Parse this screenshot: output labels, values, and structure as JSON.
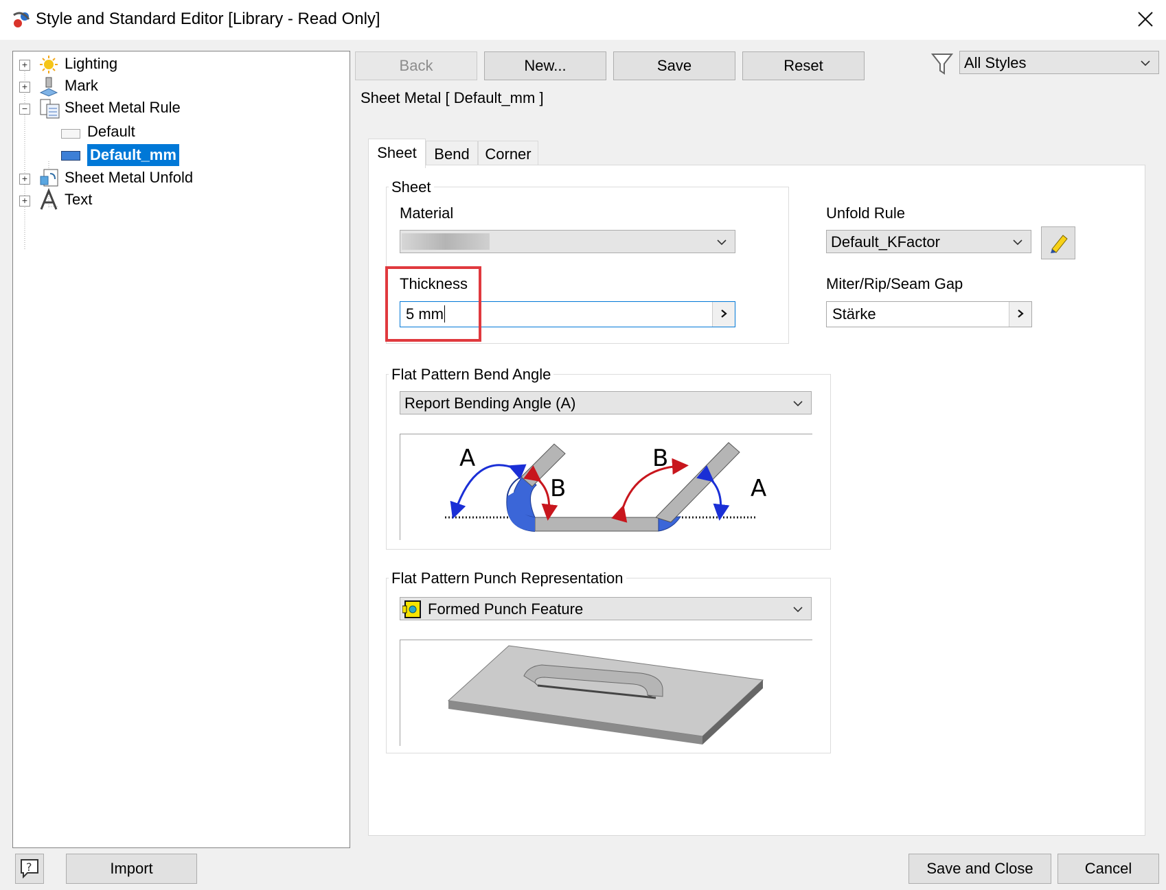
{
  "window": {
    "title": "Style and Standard Editor [Library - Read Only]"
  },
  "tree": {
    "items": [
      {
        "label": "Lighting",
        "icon": "lighting-icon",
        "expander": "+"
      },
      {
        "label": "Mark",
        "icon": "mark-icon",
        "expander": "+"
      },
      {
        "label": "Sheet Metal Rule",
        "icon": "sheet-metal-rule-icon",
        "expander": "−"
      },
      {
        "label": "Default",
        "icon": "style-swatch-icon"
      },
      {
        "label": "Default_mm",
        "icon": "style-swatch-icon",
        "selected": true
      },
      {
        "label": "Sheet Metal Unfold",
        "icon": "sheet-metal-unfold-icon",
        "expander": "+"
      },
      {
        "label": "Text",
        "icon": "text-style-icon",
        "expander": "+"
      }
    ]
  },
  "toolbar": {
    "back": "Back",
    "new": "New...",
    "save": "Save",
    "reset": "Reset",
    "filter_value": "All Styles"
  },
  "header": {
    "style_title": "Sheet Metal [ Default_mm ]"
  },
  "tabs": [
    "Sheet",
    "Bend",
    "Corner"
  ],
  "sheet_group": {
    "title": "Sheet",
    "material_label": "Material",
    "material_value": "",
    "thickness_label": "Thickness",
    "thickness_value": "5 mm"
  },
  "unfold": {
    "label": "Unfold Rule",
    "value": "Default_KFactor",
    "gap_label": "Miter/Rip/Seam Gap",
    "gap_value": "Stärke"
  },
  "bend_angle": {
    "title": "Flat Pattern Bend Angle",
    "value": "Report Bending Angle (A)",
    "diagram_labels": [
      "A",
      "B",
      "B",
      "A"
    ]
  },
  "punch": {
    "title": "Flat Pattern Punch Representation",
    "value": "Formed Punch Feature"
  },
  "footer": {
    "import": "Import",
    "save_close": "Save and Close",
    "cancel": "Cancel"
  },
  "colors": {
    "selection": "#0078d7",
    "highlight": "#e0393e",
    "arrow_blue": "#1a2fd6",
    "arrow_red": "#c8161d",
    "bend_fill": "#3b66d8"
  }
}
